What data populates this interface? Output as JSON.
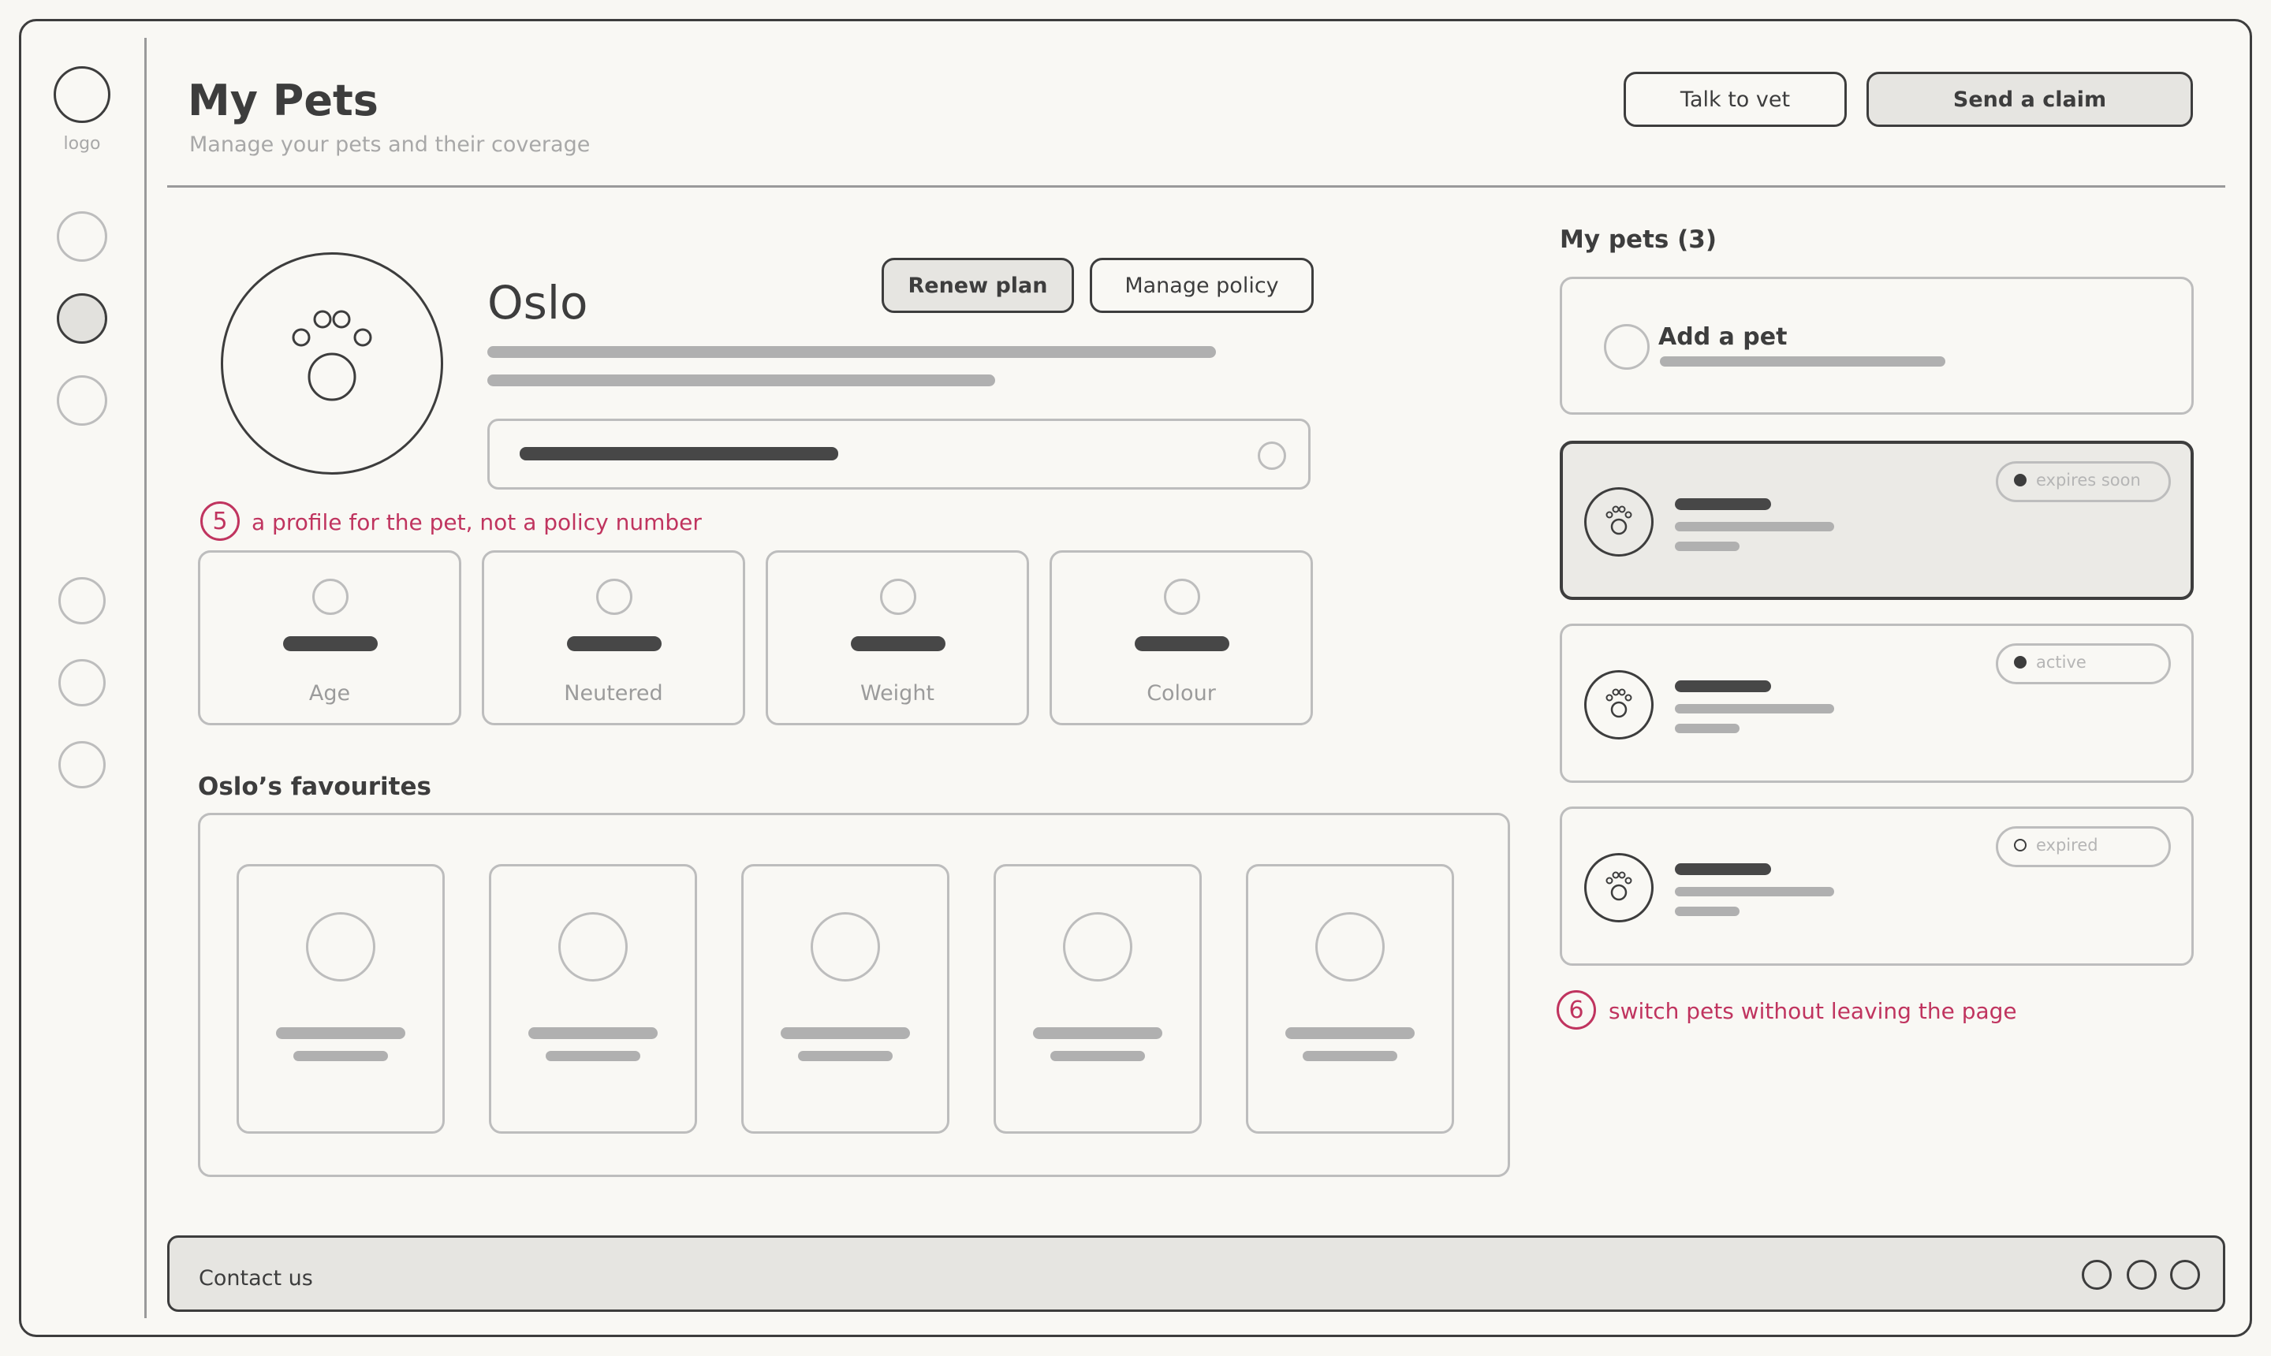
{
  "sidebar": {
    "logo_label": "logo"
  },
  "header": {
    "title": "My Pets",
    "subtitle": "Manage your pets and their coverage",
    "talk_to_vet_label": "Talk to vet",
    "send_claim_label": "Send a claim"
  },
  "profile": {
    "pet_name": "Oslo",
    "renew_plan_label": "Renew plan",
    "manage_policy_label": "Manage policy",
    "icon": "paw-icon",
    "stats": [
      {
        "label": "Age"
      },
      {
        "label": "Neutered"
      },
      {
        "label": "Weight"
      },
      {
        "label": "Colour"
      }
    ]
  },
  "annotations": {
    "note5_number": "5",
    "note5_text": "a profile for the pet, not a policy number",
    "note6_number": "6",
    "note6_text": "switch pets without leaving the page",
    "color": "#c0345f"
  },
  "favourites": {
    "heading": "Oslo’s favourites"
  },
  "pets_panel": {
    "heading": "My pets (3)",
    "add_pet_label": "Add a pet",
    "pets": [
      {
        "status": "expires soon",
        "status_dot": "filled",
        "selected": true
      },
      {
        "status": "active",
        "status_dot": "filled",
        "selected": false
      },
      {
        "status": "expired",
        "status_dot": "empty",
        "selected": false
      }
    ]
  },
  "footer": {
    "contact_label": "Contact us"
  }
}
